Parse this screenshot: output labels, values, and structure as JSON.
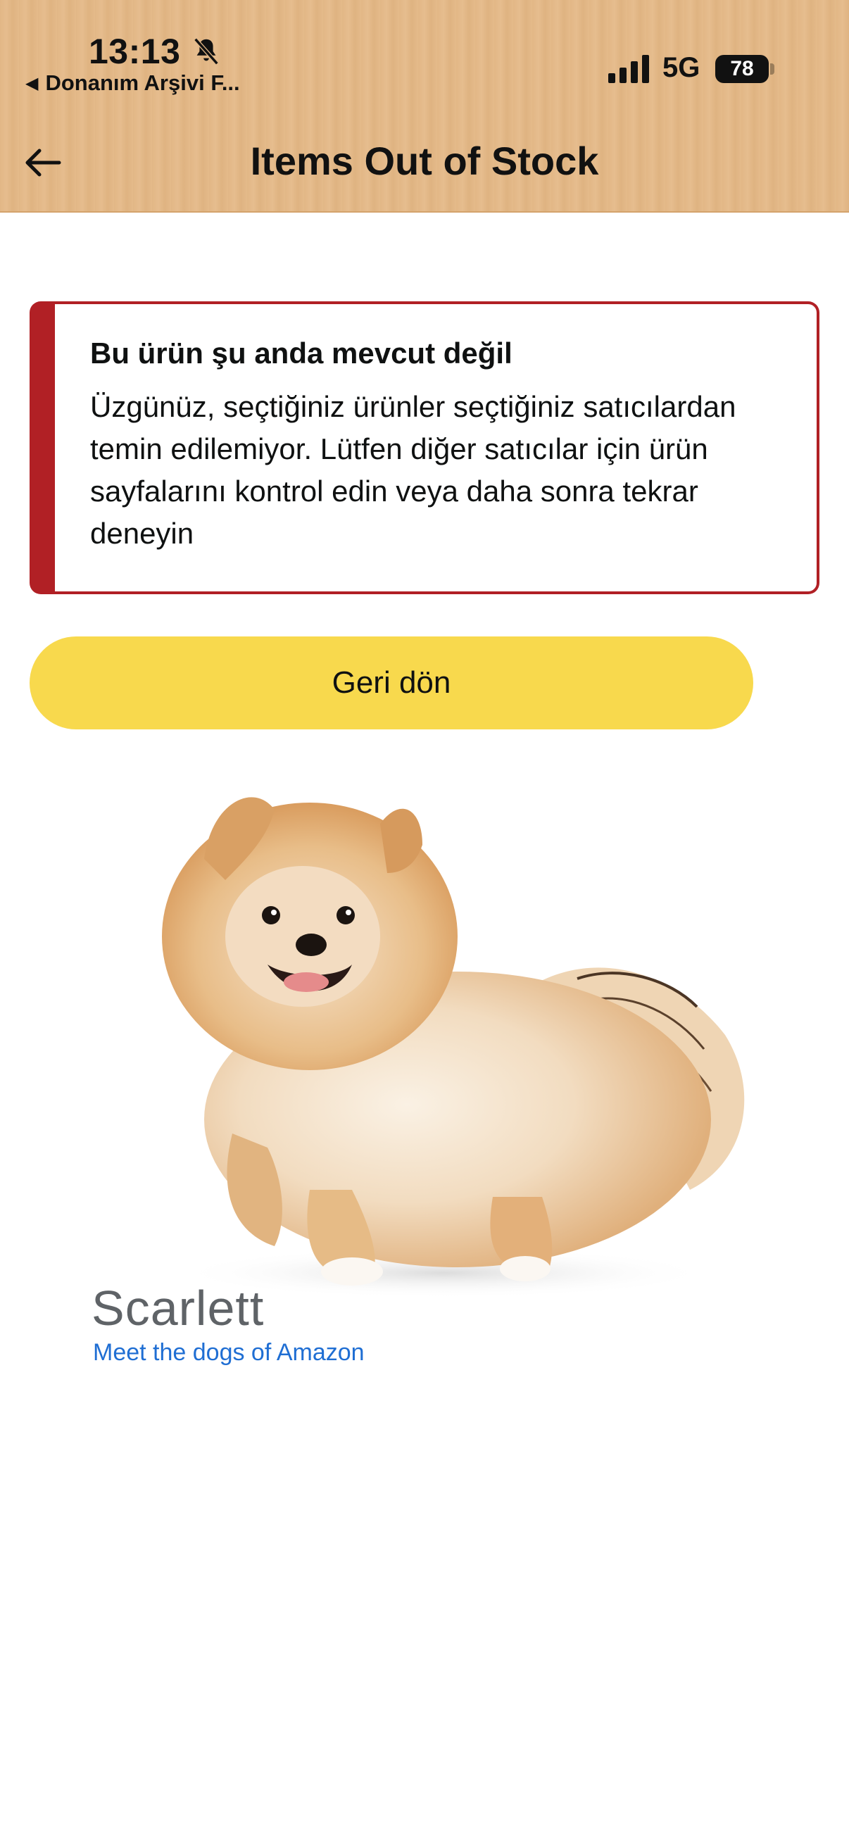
{
  "status_bar": {
    "time": "13:13",
    "back_app": "Donanım Arşivi F...",
    "network": "5G",
    "battery": "78"
  },
  "header": {
    "title": "Items Out of Stock"
  },
  "alert": {
    "heading": "Bu ürün şu anda mevcut değil",
    "body": "Üzgünüz, seçtiğiniz ürünler seçtiğiniz satıcılardan temin edilemiyor. Lütfen diğer satıcılar için ürün sayfalarını kontrol edin veya daha sonra tekrar deneyin",
    "accent_color": "#b12025"
  },
  "actions": {
    "back_label": "Geri dön",
    "button_color": "#f8d94d"
  },
  "dog": {
    "name": "Scarlett",
    "link": "Meet the dogs of Amazon"
  },
  "icons": {
    "nav_back": "arrow-left-icon",
    "silent": "bell-slash-icon",
    "signal": "signal-bars-icon"
  }
}
